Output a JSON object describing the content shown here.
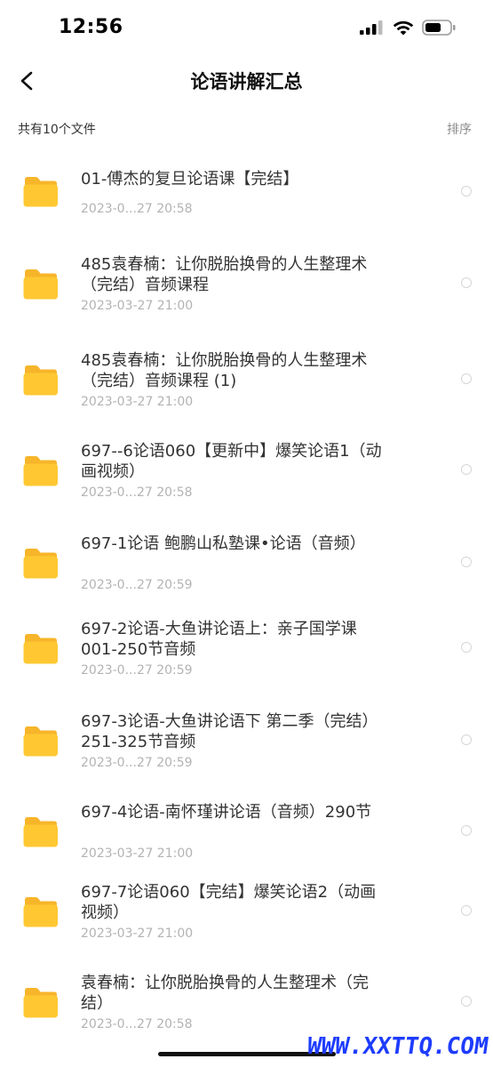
{
  "status_bar": {
    "time": "12:56"
  },
  "nav": {
    "title": "论语讲解汇总"
  },
  "subheader": {
    "file_count": "共有10个文件",
    "sort_label": "排序"
  },
  "files": [
    {
      "name": "01-傅杰的复旦论语课【完结】",
      "date": "2023-0...27 20:58"
    },
    {
      "name": "485袁春楠：让你脱胎换骨的人生整理术（完结）音频课程",
      "date": "2023-03-27 21:00"
    },
    {
      "name": "485袁春楠：让你脱胎换骨的人生整理术（完结）音频课程 (1)",
      "date": "2023-03-27 21:00"
    },
    {
      "name": "697--6论语060【更新中】爆笑论语1（动画视频）",
      "date": "2023-0...27 20:58"
    },
    {
      "name": "697-1论语 鲍鹏山私塾课•论语（音频）",
      "date": "2023-0...27 20:59"
    },
    {
      "name": "697-2论语-大鱼讲论语上：亲子国学课001-250节音频",
      "date": "2023-0...27 20:59"
    },
    {
      "name": "697-3论语-大鱼讲论语下 第二季（完结）251-325节音频",
      "date": "2023-0...27 20:59"
    },
    {
      "name": "697-4论语-南怀瑾讲论语（音频）290节",
      "date": "2023-03-27 21:00"
    },
    {
      "name": "697-7论语060【完结】爆笑论语2（动画视频）",
      "date": "2023-03-27 21:00"
    },
    {
      "name": "袁春楠：让你脱胎换骨的人生整理术（完结）",
      "date": "2023-0...27 20:58"
    }
  ],
  "watermark": "WWW.XXTTQ.COM",
  "colors": {
    "folder": "#ffc833",
    "folder_tab": "#f7b52a",
    "watermark": "#1e3cff"
  },
  "icons": [
    "back-icon",
    "folder-icon",
    "signal-icon",
    "wifi-icon",
    "battery-icon"
  ]
}
